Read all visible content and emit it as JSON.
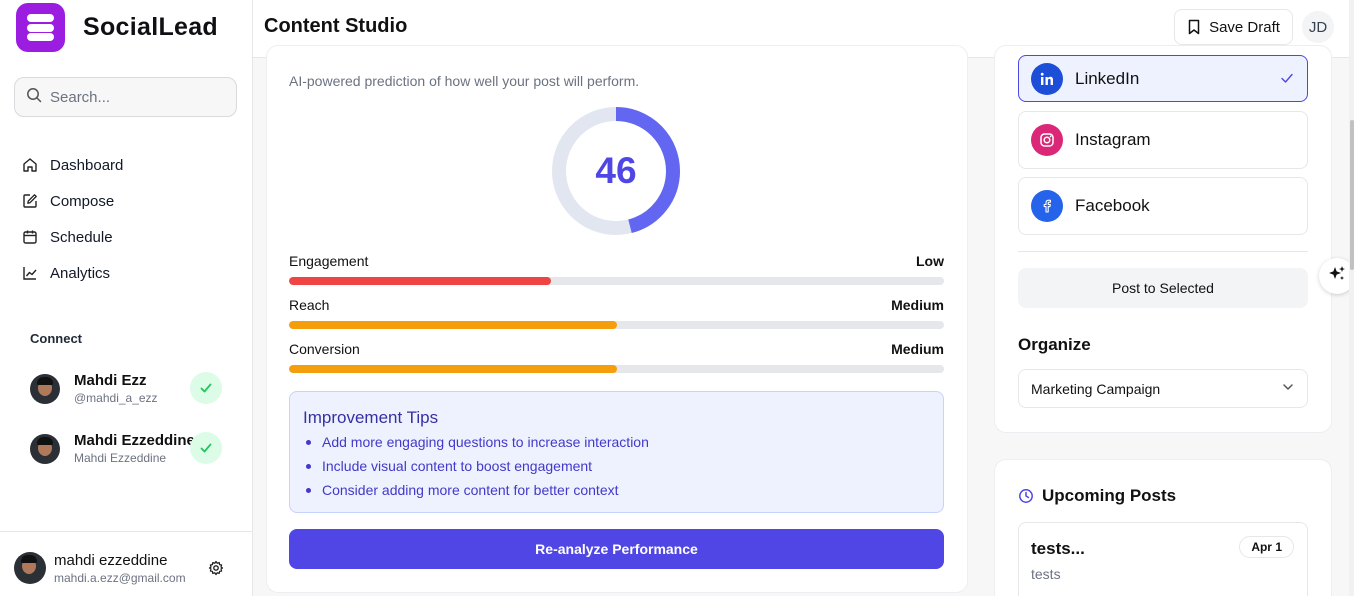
{
  "brand": {
    "name": "SocialLead",
    "logo_color": "#9b1de0"
  },
  "search": {
    "placeholder": "Search..."
  },
  "nav": {
    "items": [
      {
        "label": "Dashboard",
        "icon": "home-icon"
      },
      {
        "label": "Compose",
        "icon": "edit-icon"
      },
      {
        "label": "Schedule",
        "icon": "calendar-icon"
      },
      {
        "label": "Analytics",
        "icon": "chart-line-icon"
      }
    ]
  },
  "connect": {
    "label": "Connect",
    "accounts": [
      {
        "name": "Mahdi Ezz",
        "sub": "@mahdi_a_ezz",
        "status": "connected"
      },
      {
        "name": "Mahdi Ezzeddine",
        "sub": "Mahdi Ezzeddine",
        "status": "connected"
      }
    ]
  },
  "user": {
    "name": "mahdi ezzeddine",
    "email": "mahdi.a.ezz@gmail.com"
  },
  "header": {
    "title": "Content Studio",
    "save_label": "Save Draft",
    "avatar_initials": "JD"
  },
  "performance": {
    "subtitle": "AI-powered prediction of how well your post will perform.",
    "score": "46",
    "score_fraction": 0.46,
    "metrics": [
      {
        "label": "Engagement",
        "level": "Low",
        "fraction": 0.4,
        "color": "#ef4444"
      },
      {
        "label": "Reach",
        "level": "Medium",
        "fraction": 0.5,
        "color": "#f59e0b"
      },
      {
        "label": "Conversion",
        "level": "Medium",
        "fraction": 0.5,
        "color": "#f59e0b"
      }
    ],
    "tips": {
      "title": "Improvement Tips",
      "items": [
        "Add more engaging questions to increase interaction",
        "Include visual content to boost engagement",
        "Consider adding more content for better context"
      ]
    },
    "reanalyze_label": "Re-analyze Performance"
  },
  "platforms": {
    "items": [
      {
        "name": "LinkedIn",
        "selected": true,
        "color": "#1d4ed8",
        "icon": "linkedin-icon"
      },
      {
        "name": "Instagram",
        "selected": false,
        "color": "#db2777",
        "icon": "instagram-icon"
      },
      {
        "name": "Facebook",
        "selected": false,
        "color": "#2563eb",
        "icon": "facebook-icon"
      }
    ],
    "post_label": "Post to Selected"
  },
  "organize": {
    "label": "Organize",
    "selected": "Marketing Campaign"
  },
  "upcoming": {
    "title": "Upcoming Posts",
    "posts": [
      {
        "name": "tests...",
        "desc": "tests",
        "date": "Apr 1"
      }
    ]
  },
  "colors": {
    "accent": "#4f46e5",
    "success": "#22c55e"
  }
}
